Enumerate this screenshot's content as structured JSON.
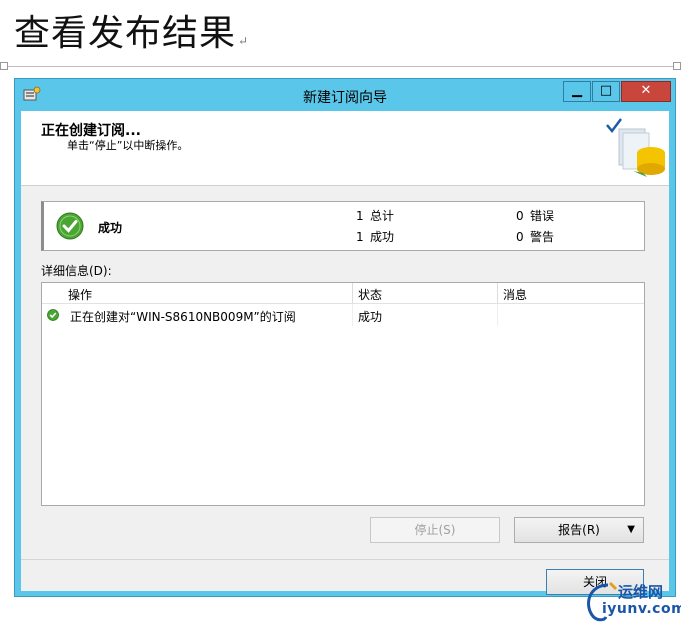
{
  "doc": {
    "heading": "查看发布结果",
    "para_mark": "↵"
  },
  "window": {
    "title": "新建订阅向导",
    "buttons": {
      "minimize": "▁",
      "maximize": "□",
      "close": "✕"
    }
  },
  "header": {
    "title": "正在创建订阅...",
    "subtitle": "单击“停止”以中断操作。"
  },
  "status": {
    "label": "成功",
    "total_count": "1",
    "total_label": "总计",
    "success_count": "1",
    "success_label": "成功",
    "error_count": "0",
    "error_label": "错误",
    "warning_count": "0",
    "warning_label": "警告"
  },
  "details": {
    "label": "详细信息(D):",
    "columns": [
      "操作",
      "状态",
      "消息"
    ],
    "rows": [
      {
        "action": "正在创建对“WIN-S8610NB009M”的订阅",
        "status": "成功",
        "message": ""
      }
    ]
  },
  "buttons": {
    "stop": "停止(S)",
    "report": "报告(R)",
    "close": "关闭"
  },
  "icons": {
    "success": "check-circle-icon",
    "row_success": "check-circle-small-icon",
    "report_arrow": "▼"
  },
  "colors": {
    "titlebar": "#5ac6ea",
    "close_button": "#c9463d",
    "success": "#4aa532"
  },
  "watermark": {
    "text": "运维网",
    "url": "iyunv.com"
  }
}
